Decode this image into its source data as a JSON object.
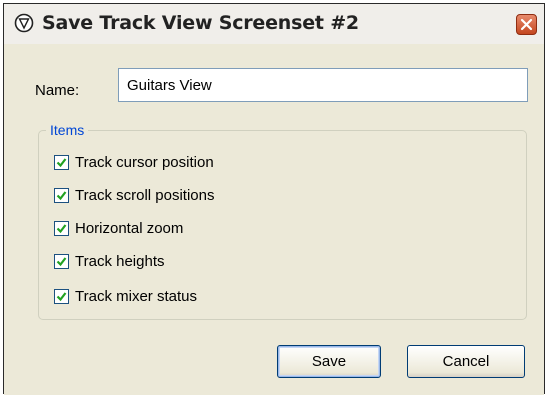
{
  "dialog": {
    "title": "Save Track View Screenset #2",
    "name_label": "Name:",
    "name_value": "Guitars View",
    "items_legend": "Items",
    "items": [
      {
        "label": "Track cursor position",
        "checked": true
      },
      {
        "label": "Track scroll positions",
        "checked": true
      },
      {
        "label": "Horizontal zoom",
        "checked": true
      },
      {
        "label": "Track heights",
        "checked": true
      },
      {
        "label": "Track mixer status",
        "checked": true
      }
    ],
    "save_label": "Save",
    "cancel_label": "Cancel"
  },
  "icons": {
    "app": "reaper-logo-icon",
    "close": "close-icon",
    "check": "checkmark-icon"
  },
  "colors": {
    "dialog_bg": "#ece9d8",
    "legend_text": "#0046d5",
    "check_mark": "#21a121",
    "close_button": "#c3461f"
  }
}
